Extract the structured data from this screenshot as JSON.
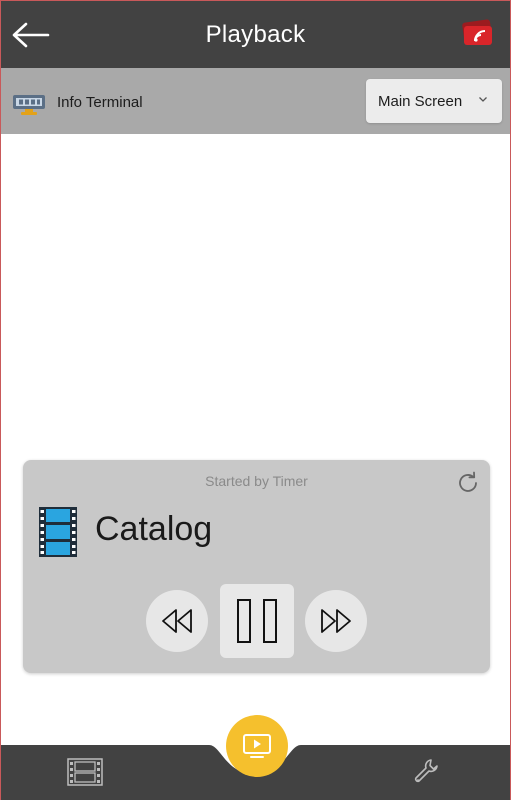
{
  "header": {
    "title": "Playback",
    "back_icon": "arrow-left-icon",
    "cast_icon": "screen-cast-icon",
    "colors": {
      "bar": "#424242",
      "cast_red": "#d9252a"
    }
  },
  "device": {
    "icon": "info-terminal-icon",
    "name": "Info Terminal",
    "screen_select": {
      "value": "Main Screen",
      "icon": "chevron-down-icon"
    },
    "colors": {
      "bar": "#a9a9a9"
    }
  },
  "player": {
    "started_by": "Started by Timer",
    "media_icon": "film-strip-icon",
    "media_title": "Catalog",
    "controls": {
      "rewind": "rewind-icon",
      "pause": "pause-icon",
      "forward": "fast-forward-icon",
      "refresh": "refresh-icon"
    },
    "colors": {
      "card": "#c8c8c8",
      "film_blue": "#2aa5e0"
    }
  },
  "bottom_nav": {
    "tabs": [
      {
        "icon": "film-icon"
      },
      {
        "icon": "play-screen-icon"
      },
      {
        "icon": "wrench-icon"
      }
    ],
    "colors": {
      "bar": "#424242",
      "fab": "#f5c02d"
    }
  }
}
